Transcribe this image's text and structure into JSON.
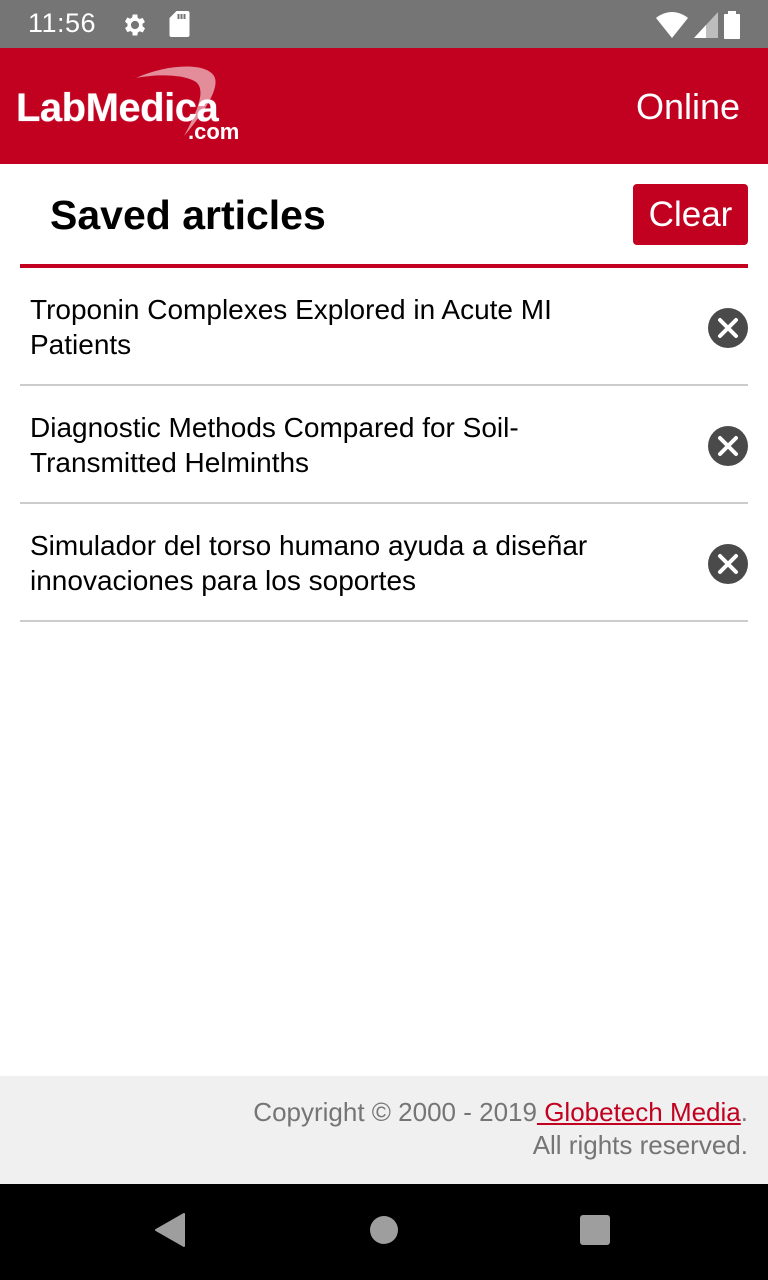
{
  "status_bar": {
    "time": "11:56",
    "icons": [
      "gear-icon",
      "sd-card-icon",
      "wifi-icon",
      "signal-icon",
      "battery-icon"
    ]
  },
  "header": {
    "logo_text": "LabMedica",
    "logo_suffix": ".com",
    "status_label": "Online",
    "brand_color": "#c20020"
  },
  "page": {
    "title": "Saved articles",
    "clear_label": "Clear"
  },
  "articles": [
    {
      "title": "Troponin Complexes Explored in Acute MI Patients",
      "remove_icon": "close-circle-icon"
    },
    {
      "title": "Diagnostic Methods Compared for Soil-Transmitted Helminths",
      "remove_icon": "close-circle-icon"
    },
    {
      "title": "Simulador del torso humano ayuda a diseñar innovaciones para los soportes",
      "remove_icon": "close-circle-icon"
    }
  ],
  "footer": {
    "copyright": "Copyright © 2000 - 2019",
    "link_text": " Globetech Media",
    "period": ".",
    "rights": "All rights reserved."
  },
  "nav_bar": {
    "buttons": [
      "back-icon",
      "home-icon",
      "recents-icon"
    ]
  }
}
